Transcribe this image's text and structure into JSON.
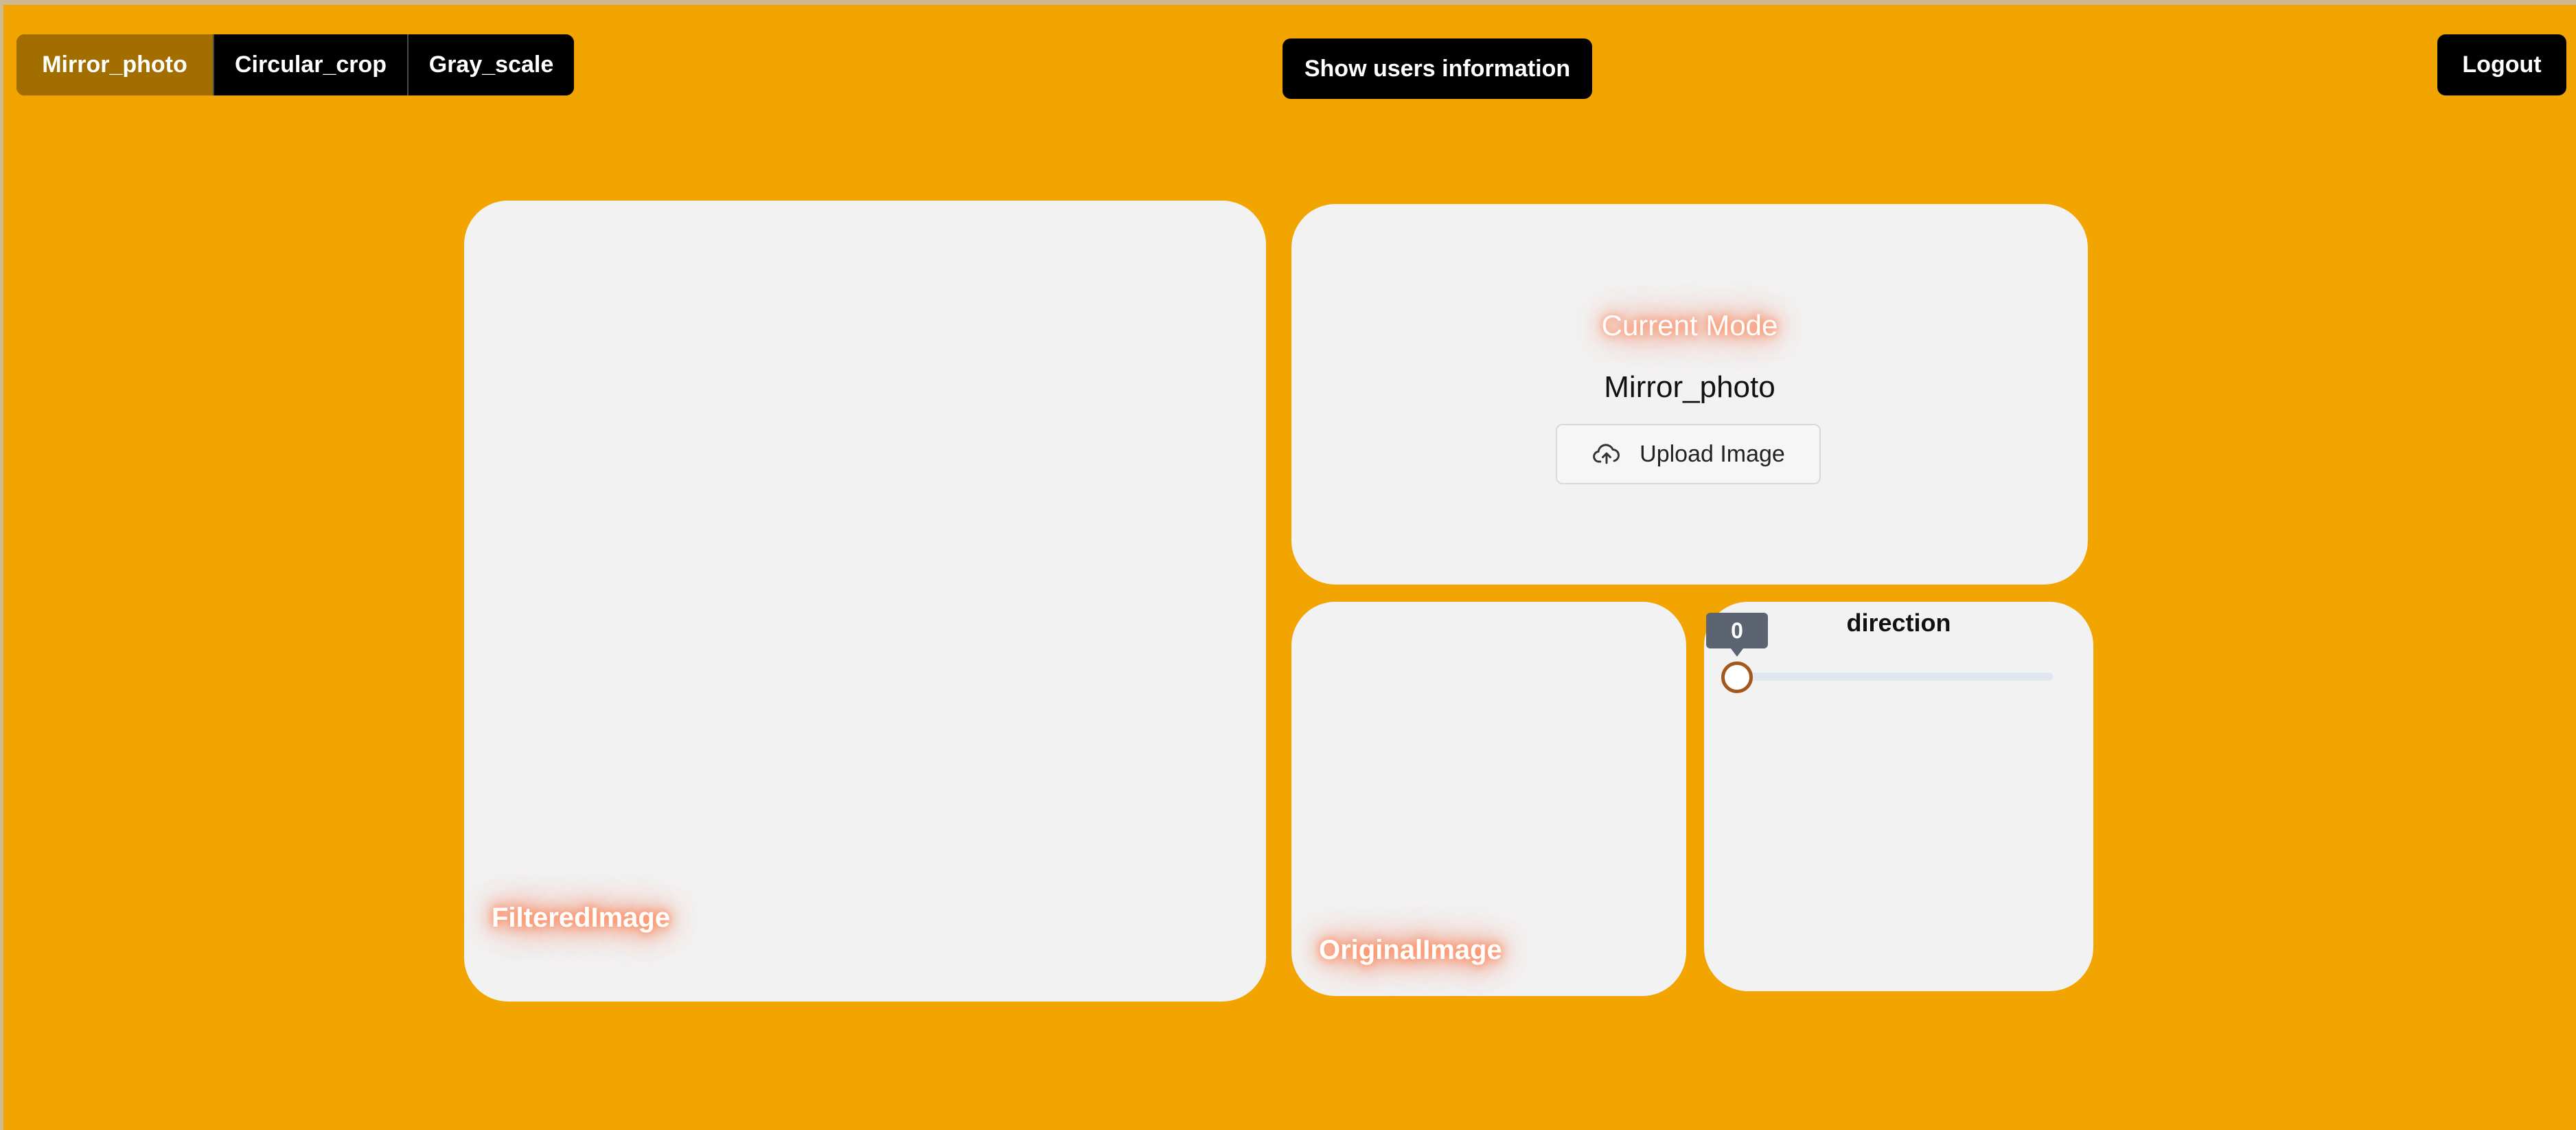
{
  "modes": {
    "items": [
      "Mirror_photo",
      "Circular_crop",
      "Gray_scale"
    ],
    "active": "Mirror_photo"
  },
  "header": {
    "users_button": "Show users information",
    "logout_button": "Logout"
  },
  "filtered_card": {
    "label": "FilteredImage"
  },
  "mode_card": {
    "heading": "Current Mode",
    "value": "Mirror_photo",
    "upload_button": "Upload Image",
    "upload_icon": "cloud-upload-icon"
  },
  "original_card": {
    "label": "OriginalImage"
  },
  "direction_card": {
    "title": "direction",
    "slider": {
      "value": "0",
      "fraction": 0
    }
  },
  "colors": {
    "background": "#f2a500",
    "active_mode": "#a36e00",
    "card": "#f2f2f2",
    "glow": "#ff8c5a",
    "slider_thumb_border": "#a3571c"
  }
}
